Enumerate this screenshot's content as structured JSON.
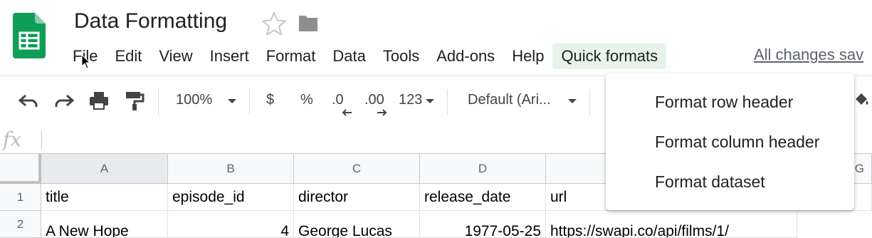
{
  "app": {
    "title": "Data Formatting",
    "save_status": "All changes sav"
  },
  "menubar": {
    "items": [
      {
        "label": "File"
      },
      {
        "label": "Edit"
      },
      {
        "label": "View"
      },
      {
        "label": "Insert"
      },
      {
        "label": "Format"
      },
      {
        "label": "Data"
      },
      {
        "label": "Tools"
      },
      {
        "label": "Add-ons"
      },
      {
        "label": "Help"
      },
      {
        "label": "Quick formats",
        "active": true
      }
    ]
  },
  "toolbar": {
    "zoom": "100%",
    "currency": "$",
    "percent": "%",
    "decrease_decimal": ".0",
    "increase_decimal": ".00",
    "number_format": "123",
    "font": "Default (Ari..."
  },
  "formula_bar": {
    "fx": "fx"
  },
  "grid": {
    "columns": [
      "A",
      "B",
      "C",
      "D",
      "G"
    ],
    "row_numbers": [
      "1",
      "2"
    ],
    "rows": [
      [
        "title",
        "episode_id",
        "director",
        "release_date",
        "url"
      ],
      [
        "A New Hope",
        "4",
        "George Lucas",
        "1977-05-25",
        "https://swapi.co/api/films/1/"
      ]
    ]
  },
  "dropdown": {
    "items": [
      {
        "label": "Format row header"
      },
      {
        "label": "Format column header"
      },
      {
        "label": "Format dataset"
      }
    ]
  },
  "colors": {
    "sheets_green": "#0f9d58",
    "menu_active_bg": "#e6f4ea",
    "icon_gray": "#5f6368"
  }
}
